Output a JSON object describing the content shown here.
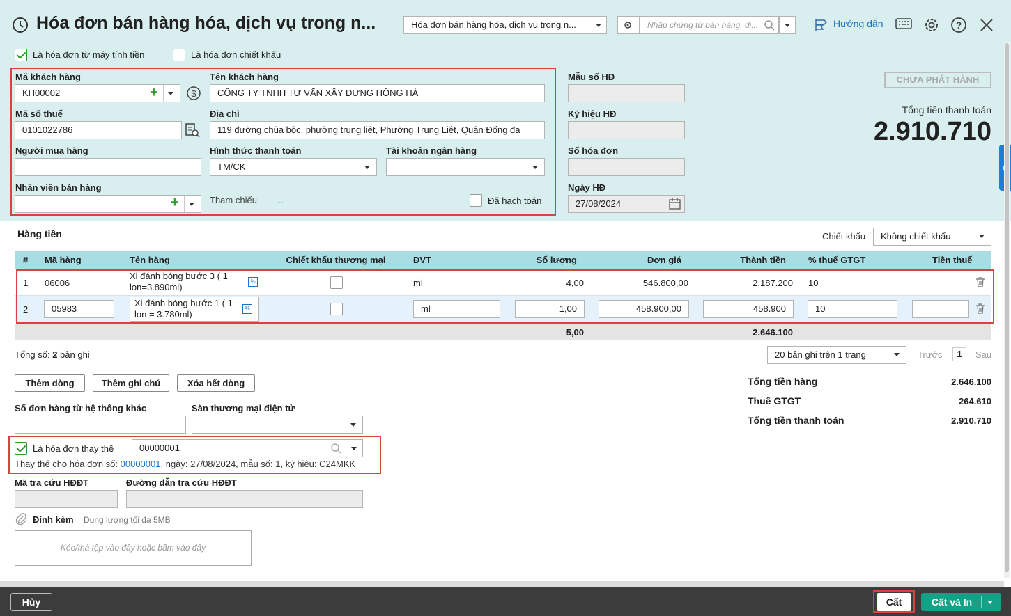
{
  "title": "Hóa đơn bán hàng hóa, dịch vụ trong n...",
  "header": {
    "doc_type": "Hóa đơn bán hàng hóa, dịch vụ trong n...",
    "search_placeholder": "Nhập chứng từ bán hàng, dị...",
    "help": "Hướng dẫn"
  },
  "options": {
    "cash_register": "Là hóa đơn từ máy tính tiền",
    "discount_invoice": "Là hóa đơn chiết khấu"
  },
  "customer": {
    "code_label": "Mã khách hàng",
    "code": "KH00002",
    "name_label": "Tên khách hàng",
    "name": "CÔNG TY TNHH TƯ VẤN XÂY DỰNG HỒNG HÀ",
    "tax_label": "Mã số thuế",
    "tax": "0101022786",
    "address_label": "Địa chỉ",
    "address": "119 đường chùa bộc, phường trung liệt, Phường Trung Liệt, Quận Đống đa",
    "buyer_label": "Người mua hàng",
    "buyer": "",
    "payment_label": "Hình thức thanh toán",
    "payment": "TM/CK",
    "bank_label": "Tài khoản ngân hàng",
    "bank": "",
    "staff_label": "Nhân viên bán hàng",
    "staff": "",
    "ref_label": "Tham chiếu",
    "ref_value": "...",
    "posted_label": "Đã hạch toán"
  },
  "invoice": {
    "form_label": "Mẫu số HĐ",
    "symbol_label": "Ký hiệu HĐ",
    "number_label": "Số hóa đơn",
    "date_label": "Ngày HĐ",
    "date": "27/08/2024",
    "status": "CHƯA PHÁT HÀNH",
    "total_label": "Tổng tiền thanh toán",
    "total": "2.910.710"
  },
  "items": {
    "section": "Hàng tiền",
    "discount_label": "Chiết khấu",
    "discount_value": "Không chiết khấu",
    "columns": [
      "#",
      "Mã hàng",
      "Tên hàng",
      "Chiết khấu thương mại",
      "ĐVT",
      "Số lượng",
      "Đơn giá",
      "Thành tiền",
      "% thuế GTGT",
      "Tiền thuế"
    ],
    "rows": [
      {
        "no": "1",
        "code": "06006",
        "name": "Xi đánh bóng bước 3 ( 1 lon=3.890ml)",
        "unit": "ml",
        "qty": "4,00",
        "price": "546.800,00",
        "amount": "2.187.200",
        "vat": "10"
      },
      {
        "no": "2",
        "code": "05983",
        "name": "Xi đánh bóng bước 1 ( 1 lon = 3.780ml)",
        "unit": "ml",
        "qty": "1,00",
        "price": "458.900,00",
        "amount": "458.900",
        "vat": "10"
      }
    ],
    "total_qty": "5,00",
    "total_amount": "2.646.100"
  },
  "paging": {
    "total_prefix": "Tổng số: ",
    "total_count": "2",
    "total_suffix": " bản ghi",
    "per_page": "20 bản ghi trên 1 trang",
    "prev": "Trước",
    "page": "1",
    "next": "Sau"
  },
  "actions": {
    "add_row": "Thêm dòng",
    "add_note": "Thêm ghi chú",
    "delete_all": "Xóa hết dòng"
  },
  "summary": {
    "goods_label": "Tổng tiền hàng",
    "goods": "2.646.100",
    "vat_label": "Thuế GTGT",
    "vat": "264.610",
    "total_label": "Tổng tiền thanh toán",
    "total": "2.910.710"
  },
  "other": {
    "order_label": "Số đơn hàng từ hệ thống khác",
    "ecom_label": "Sàn thương mại điện tử",
    "replace_label": "Là hóa đơn thay thế",
    "replace_value": "00000001",
    "replace_info_prefix": "Thay thế cho hóa đơn số:",
    "replace_info_no": "00000001",
    "replace_info_rest": ", ngày:  27/08/2024, mẫu số:  1, ký hiệu:  C24MKK",
    "lookup_code_label": "Mã tra cứu HĐĐT",
    "lookup_url_label": "Đường dẫn tra cứu HĐĐT",
    "attach_label": "Đính kèm",
    "attach_hint": "Dung lượng tối đa 5MB",
    "drop_hint": "Kéo/thả tệp vào đây hoặc bấm vào đây"
  },
  "footer": {
    "cancel": "Hủy",
    "save": "Cất",
    "save_print": "Cất và In"
  },
  "colors": {
    "accent": "#16a085",
    "red": "#d9423e",
    "link": "#1a73c8"
  }
}
